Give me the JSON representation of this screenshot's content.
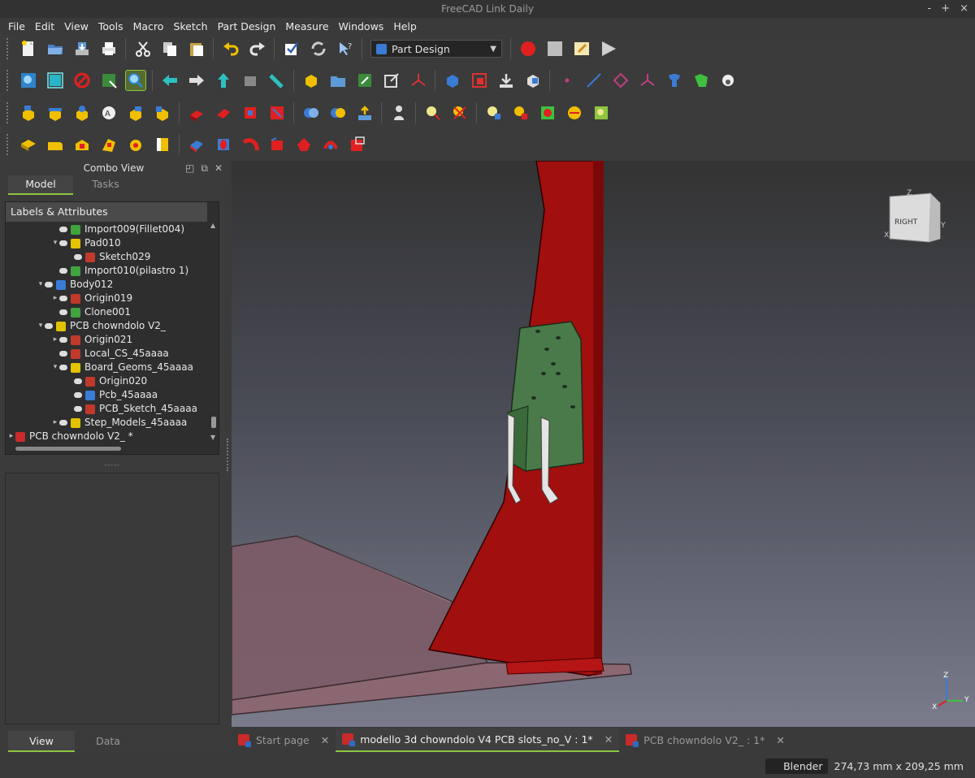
{
  "window": {
    "title": "FreeCAD Link Daily",
    "controls": [
      "-",
      "+",
      "×"
    ]
  },
  "menu": [
    "File",
    "Edit",
    "View",
    "Tools",
    "Macro",
    "Sketch",
    "Part Design",
    "Measure",
    "Windows",
    "Help"
  ],
  "workbench": {
    "selected": "Part Design"
  },
  "combo": {
    "title": "Combo View",
    "tabs": [
      "Model",
      "Tasks"
    ],
    "tree_header": "Labels & Attributes",
    "splitter": "-----"
  },
  "tree": [
    {
      "label": "Import009(Fillet004)",
      "indent": 3,
      "arrow": "",
      "color": "#3fa33f"
    },
    {
      "label": "Pad010",
      "indent": 3,
      "arrow": "▾",
      "color": "#e3c200"
    },
    {
      "label": "Sketch029",
      "indent": 4,
      "arrow": "",
      "color": "#c0392b"
    },
    {
      "label": "Import010(pilastro 1)",
      "indent": 3,
      "arrow": "",
      "color": "#3fa33f"
    },
    {
      "label": "Body012",
      "indent": 2,
      "arrow": "▾",
      "color": "#3a7bd5"
    },
    {
      "label": "Origin019",
      "indent": 3,
      "arrow": "▸",
      "color": "#c0392b"
    },
    {
      "label": "Clone001",
      "indent": 3,
      "arrow": "",
      "color": "#3fa33f"
    },
    {
      "label": "PCB chowndolo V2_",
      "indent": 2,
      "arrow": "▾",
      "color": "#e3c200"
    },
    {
      "label": "Origin021",
      "indent": 3,
      "arrow": "▸",
      "color": "#c0392b"
    },
    {
      "label": "Local_CS_45aaaa",
      "indent": 3,
      "arrow": "",
      "color": "#c0392b"
    },
    {
      "label": "Board_Geoms_45aaaa",
      "indent": 3,
      "arrow": "▾",
      "color": "#e3c200"
    },
    {
      "label": "Origin020",
      "indent": 4,
      "arrow": "",
      "color": "#c0392b"
    },
    {
      "label": "Pcb_45aaaa",
      "indent": 4,
      "arrow": "",
      "color": "#3a7bd5"
    },
    {
      "label": "PCB_Sketch_45aaaa",
      "indent": 4,
      "arrow": "",
      "color": "#c0392b"
    },
    {
      "label": "Step_Models_45aaaa",
      "indent": 3,
      "arrow": "▸",
      "color": "#e3c200"
    },
    {
      "label": "PCB chowndolo V2_ *",
      "indent": 0,
      "arrow": "▸",
      "color": "#c92a2a"
    }
  ],
  "bottom_tabs": [
    "View",
    "Data"
  ],
  "doc_tabs": [
    {
      "label": "Start page",
      "active": false
    },
    {
      "label": "modello 3d chowndolo V4 PCB slots_no_V : 1*",
      "active": true
    },
    {
      "label": "PCB chowndolo V2_ : 1*",
      "active": false
    }
  ],
  "navcube": {
    "face": "RIGHT",
    "axes": [
      "Z",
      "Y",
      "X"
    ]
  },
  "axis_triad": [
    "Z",
    "Y",
    "X"
  ],
  "status": {
    "nav_style": "Blender",
    "dimensions": "274,73 mm x 209,25 mm"
  }
}
